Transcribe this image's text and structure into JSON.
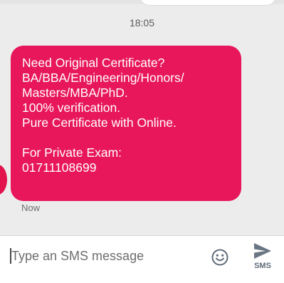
{
  "conversation": {
    "timestamp": "18:05",
    "message": {
      "lines": [
        "Need Original Certificate?",
        "BA/BBA/Engineering/Honors/",
        "Masters/MBA/PhD.",
        "100% verification.",
        "Pure Certificate with Online."
      ],
      "lines_after_gap": [
        "For Private Exam:",
        "01711108699"
      ],
      "time": "Now",
      "bubble_color": "#e8165a"
    }
  },
  "composer": {
    "placeholder": "Type an SMS message",
    "emoji_icon": "smiley-face-icon",
    "send_icon": "send-arrow-icon",
    "send_label": "SMS"
  }
}
